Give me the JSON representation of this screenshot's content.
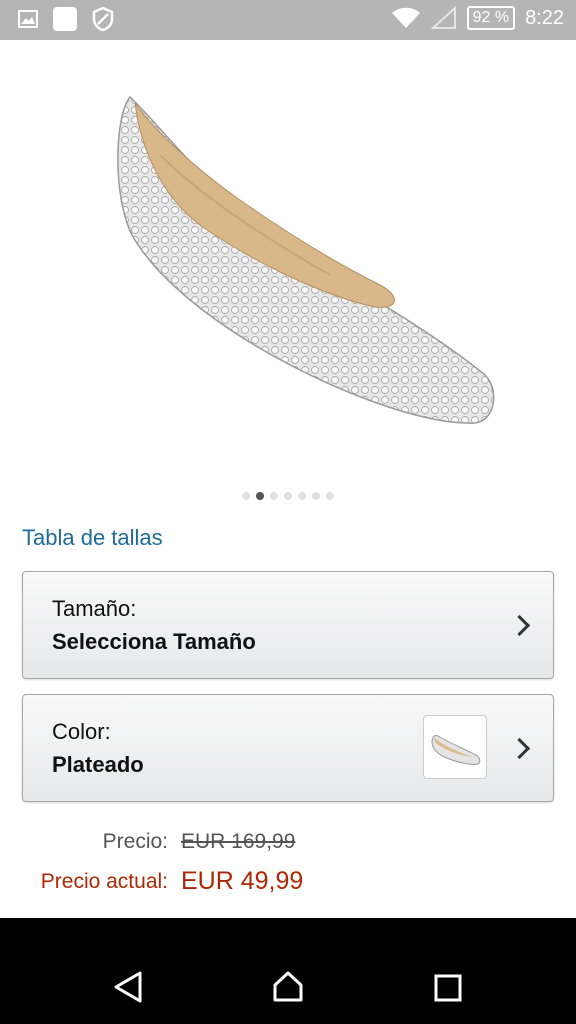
{
  "status_bar": {
    "battery": "92 %",
    "time": "8:22",
    "icons": [
      "image-icon",
      "app-icon",
      "shield-icon",
      "wifi-icon",
      "signal-icon",
      "battery-icon"
    ]
  },
  "product": {
    "carousel": {
      "dots": 7,
      "active_index": 1
    },
    "size_chart_link": "Tabla de tallas",
    "size_selector": {
      "label": "Tamaño:",
      "value": "Selecciona Tamaño"
    },
    "color_selector": {
      "label": "Color:",
      "value": "Plateado"
    },
    "price": {
      "list_label": "Precio:",
      "list_value": "EUR 169,99",
      "current_label": "Precio actual:",
      "current_value": "EUR 49,99"
    }
  },
  "colors": {
    "link": "#1f6b99",
    "price_red": "#b12704",
    "status_bar": "#b5b5b5"
  },
  "navbar": {
    "icons": [
      "back-icon",
      "home-icon",
      "recents-icon"
    ]
  }
}
